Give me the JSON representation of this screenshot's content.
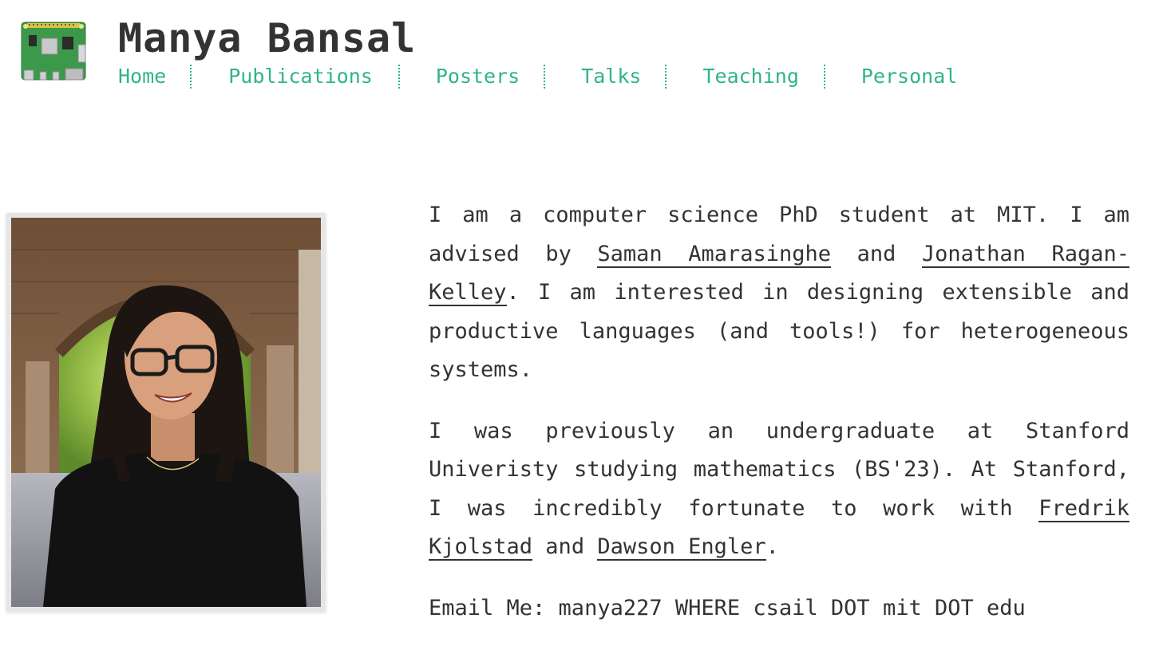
{
  "header": {
    "title": "Manya Bansal",
    "logo_icon": "raspberry-pi-board-icon"
  },
  "nav": {
    "items": [
      {
        "label": "Home"
      },
      {
        "label": "Publications"
      },
      {
        "label": "Posters"
      },
      {
        "label": "Talks"
      },
      {
        "label": "Teaching"
      },
      {
        "label": "Personal"
      }
    ],
    "color": "#2fb48a"
  },
  "photo": {
    "icon": "profile-photo"
  },
  "bio": {
    "p1_a": "I am a computer science PhD student at MIT. I am advised by ",
    "p1_link1": "Saman Amarasinghe",
    "p1_b": " and ",
    "p1_link2": "Jonathan Ragan-Kelley",
    "p1_c": ". I am interested in designing extensible and productive languages (and tools!) for heterogeneous systems.",
    "p2_a": "I was previously an undergraduate at Stanford Univeristy studying mathematics (BS'23). At Stanford, I was incredibly fortunate to work with ",
    "p2_link1": "Fredrik Kjolstad",
    "p2_b": " and ",
    "p2_link2": "Dawson Engler",
    "p2_c": ".",
    "email": "Email Me: manya227 WHERE csail DOT mit DOT edu"
  }
}
